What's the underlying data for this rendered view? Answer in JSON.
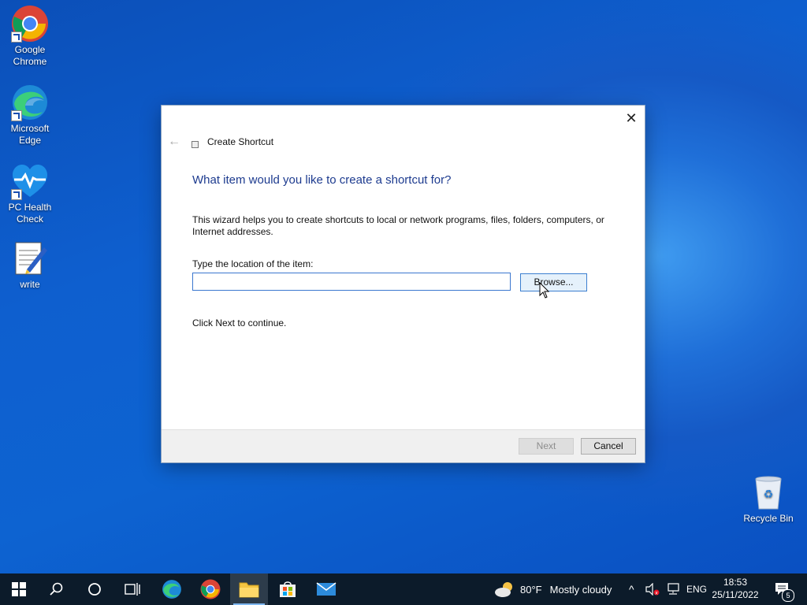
{
  "desktop": {
    "icons": [
      {
        "label": "Google Chrome"
      },
      {
        "label": "Microsoft Edge"
      },
      {
        "label": "PC Health Check"
      },
      {
        "label": "write"
      }
    ],
    "recycle_bin": "Recycle Bin"
  },
  "dialog": {
    "wizard_title": "Create Shortcut",
    "heading": "What item would you like to create a shortcut for?",
    "description": "This wizard helps you to create shortcuts to local or network programs, files, folders, computers, or Internet addresses.",
    "location_label": "Type the location of the item:",
    "location_value": "",
    "browse_label": "Browse...",
    "continue_text": "Click Next to continue.",
    "next_label": "Next",
    "cancel_label": "Cancel"
  },
  "taskbar": {
    "weather_temp": "80°F",
    "weather_text": "Mostly cloudy",
    "language": "ENG",
    "time": "18:53",
    "date": "25/11/2022",
    "notification_count": "5"
  },
  "colors": {
    "accent": "#1d3b8f",
    "taskbar": "#0c1b2a"
  }
}
